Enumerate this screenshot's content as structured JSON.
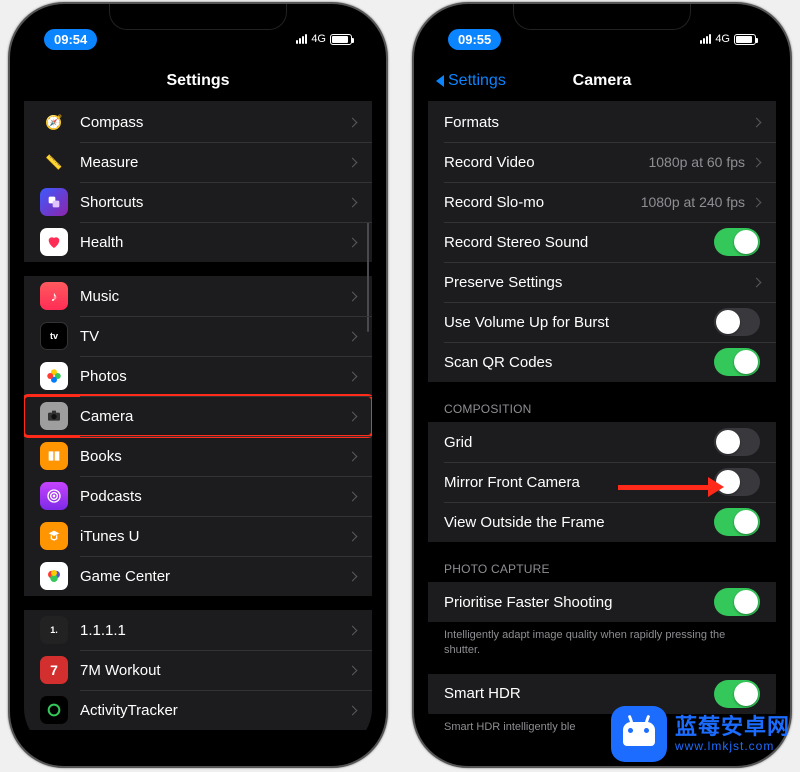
{
  "status": {
    "time_left": "09:54",
    "time_right": "09:55",
    "network": "4G"
  },
  "left": {
    "title": "Settings",
    "rows": {
      "g1": [
        {
          "label": "Compass"
        },
        {
          "label": "Measure"
        },
        {
          "label": "Shortcuts"
        },
        {
          "label": "Health"
        }
      ],
      "g2": [
        {
          "label": "Music"
        },
        {
          "label": "TV"
        },
        {
          "label": "Photos"
        },
        {
          "label": "Camera"
        },
        {
          "label": "Books"
        },
        {
          "label": "Podcasts"
        },
        {
          "label": "iTunes U"
        },
        {
          "label": "Game Center"
        }
      ],
      "g3": [
        {
          "label": "1.1.1.1"
        },
        {
          "label": "7M Workout"
        },
        {
          "label": "ActivityTracker"
        }
      ]
    }
  },
  "right": {
    "back": "Settings",
    "title": "Camera",
    "rows": {
      "formats": "Formats",
      "record_video": "Record Video",
      "record_video_detail": "1080p at 60 fps",
      "record_slomo": "Record Slo-mo",
      "record_slomo_detail": "1080p at 240 fps",
      "stereo": "Record Stereo Sound",
      "preserve": "Preserve Settings",
      "vol_burst": "Use Volume Up for Burst",
      "scan_qr": "Scan QR Codes"
    },
    "composition_header": "COMPOSITION",
    "composition": {
      "grid": "Grid",
      "mirror": "Mirror Front Camera",
      "view_outside": "View Outside the Frame"
    },
    "photo_capture_header": "PHOTO CAPTURE",
    "photo_capture": {
      "prioritise": "Prioritise Faster Shooting",
      "prioritise_footer": "Intelligently adapt image quality when rapidly pressing the shutter.",
      "smart_hdr": "Smart HDR",
      "smart_hdr_footer": "Smart HDR intelligently ble"
    }
  },
  "watermark": {
    "title": "蓝莓安卓网",
    "url": "www.lmkjst.com"
  }
}
